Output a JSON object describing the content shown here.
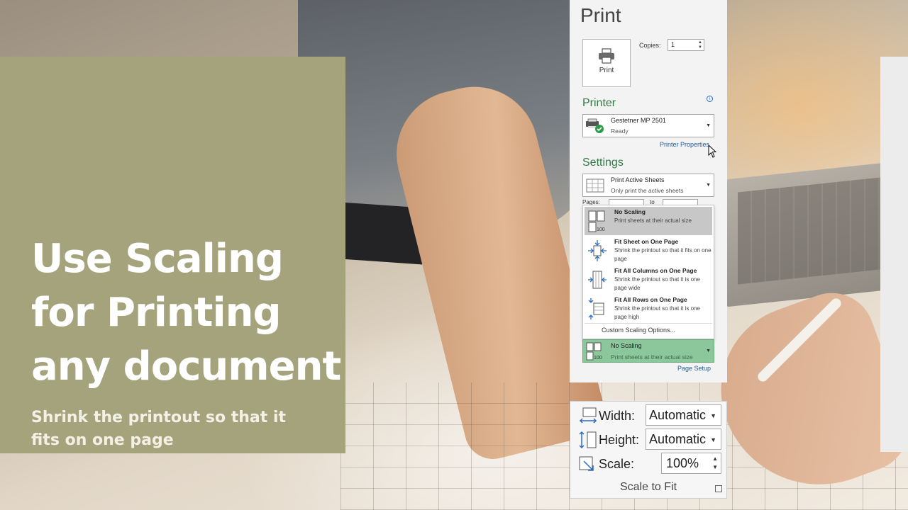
{
  "title_card": {
    "headline_lines": [
      "Use Scaling",
      "for Printing",
      "any document"
    ],
    "subtitle_lines": [
      "Shrink the printout so that it",
      "fits on one page"
    ]
  },
  "print_panel": {
    "title": "Print",
    "print_button_label": "Print",
    "copies_label": "Copies:",
    "copies_value": "1",
    "printer_heading": "Printer",
    "printer_name": "Gestetner MP 2501",
    "printer_status": "Ready",
    "printer_properties_link": "Printer Properties",
    "settings_heading": "Settings",
    "print_what": {
      "title": "Print Active Sheets",
      "desc": "Only print the active sheets"
    },
    "pages_label": "Pages:",
    "pages_to": "to",
    "scaling_menu": {
      "items": [
        {
          "title": "No Scaling",
          "desc": "Print sheets at their actual size",
          "selected": true
        },
        {
          "title": "Fit Sheet on One Page",
          "desc": "Shrink the printout so that it fits on one page",
          "selected": false
        },
        {
          "title": "Fit All Columns on One Page",
          "desc": "Shrink the printout so that it is one page wide",
          "selected": false
        },
        {
          "title": "Fit All Rows on One Page",
          "desc": "Shrink the printout so that it is one page high",
          "selected": false
        }
      ],
      "custom_option": "Custom Scaling Options..."
    },
    "scaling_current": {
      "title": "No Scaling",
      "desc": "Print sheets at their actual size"
    },
    "page_setup_link": "Page Setup",
    "accent_color": "#2f7a45",
    "selected_bg": "#8cc79b"
  },
  "scale_to_fit": {
    "width_label": "Width:",
    "width_value": "Automatic",
    "height_label": "Height:",
    "height_value": "Automatic",
    "scale_label": "Scale:",
    "scale_value": "100%",
    "group_label": "Scale to Fit"
  },
  "icons": [
    "printer-icon",
    "info-icon",
    "printer-ready-icon",
    "sheets-icon",
    "no-scaling-icon",
    "fit-sheet-icon",
    "fit-columns-icon",
    "fit-rows-icon",
    "width-icon",
    "height-icon",
    "scale-icon",
    "dialog-launcher-icon",
    "mouse-cursor-icon"
  ]
}
